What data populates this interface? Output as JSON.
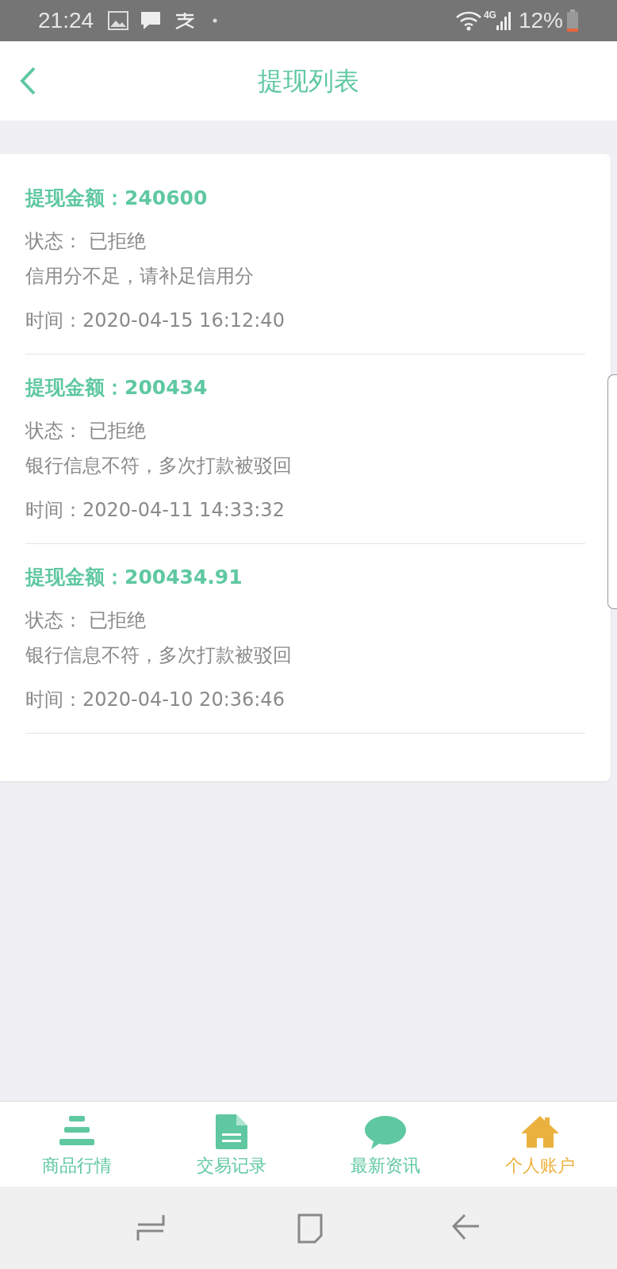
{
  "status_bar": {
    "time": "21:24",
    "network": "4G",
    "battery": "12%"
  },
  "header": {
    "title": "提现列表"
  },
  "records": [
    {
      "amount": "提现金额：240600",
      "status": "状态： 已拒绝",
      "reason": "信用分不足，请补足信用分",
      "time": "时间：2020-04-15 16:12:40"
    },
    {
      "amount": "提现金额：200434",
      "status": "状态： 已拒绝",
      "reason": "银行信息不符，多次打款被驳回",
      "time": "时间：2020-04-11 14:33:32"
    },
    {
      "amount": "提现金额：200434.91",
      "status": "状态： 已拒绝",
      "reason": "银行信息不符，多次打款被驳回",
      "time": "时间：2020-04-10 20:36:46"
    }
  ],
  "tab_bar": [
    {
      "kind": "list",
      "label": "商品行情",
      "selected": false
    },
    {
      "kind": "document",
      "label": "交易记录",
      "selected": false
    },
    {
      "kind": "chat",
      "label": "最新资讯",
      "selected": false
    },
    {
      "kind": "home",
      "label": "个人账户",
      "selected": true
    }
  ]
}
